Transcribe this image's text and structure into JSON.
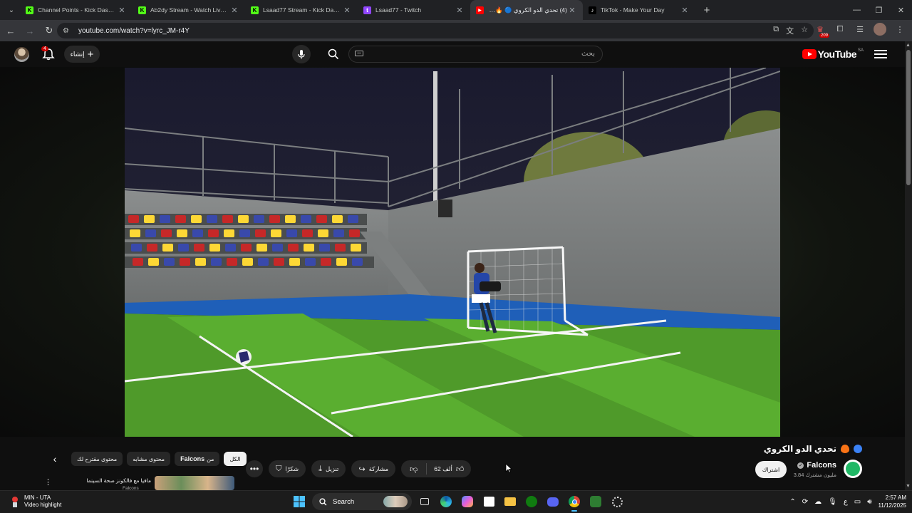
{
  "browser": {
    "tabs": [
      {
        "title": "Channel Points - Kick Dashboard",
        "favicon": "kick-icon",
        "color": "#53fc18",
        "active": false
      },
      {
        "title": "Ab2dy Stream - Watch Live on Kick",
        "favicon": "kick-icon",
        "color": "#53fc18",
        "active": false
      },
      {
        "title": "Lsaad77 Stream - Kick Dashboard",
        "favicon": "kick-icon",
        "color": "#53fc18",
        "active": false
      },
      {
        "title": "Lsaad77 - Twitch",
        "favicon": "twitch-icon",
        "color": "#9146ff",
        "active": false
      },
      {
        "title": "(4) تحدي الدو الكروي 🔵 🔥 - YouTube",
        "favicon": "youtube-icon",
        "color": "#ff0000",
        "active": true
      },
      {
        "title": "TikTok - Make Your Day",
        "favicon": "tiktok-icon",
        "color": "#ffffff",
        "active": false
      }
    ],
    "url": "youtube.com/watch?v=lyrc_JM-r4Y",
    "extension_badge": "209"
  },
  "youtube": {
    "logo_text": "YouTube",
    "region": "SA",
    "search_placeholder": "بحث",
    "create_label": "إنشاء",
    "notification_count": "4"
  },
  "video": {
    "title": "تحدي الدو الكروي",
    "channel_name": "Falcons",
    "subscribers": "3.84 مليون مشترك",
    "subscribe_label": "اشتراك",
    "like_count": "62 ألف",
    "share_label": "مشاركة",
    "download_label": "تنزيل",
    "thanks_label": "شكرًا"
  },
  "chips": {
    "all": "الكل",
    "from_channel_prefix": "من",
    "from_channel_name": "Falcons",
    "related": "محتوى مشابه",
    "recommended": "محتوى مقترح لك"
  },
  "recommendation": {
    "title": "مافيا مع فالكونز صحة السينما",
    "channel": "Falcons"
  },
  "taskbar": {
    "weather_title": "MIN - UTA",
    "weather_subtitle": "Video highlight",
    "search_label": "Search",
    "time": "2:57 AM",
    "date": "11/12/2025",
    "lang": "ع"
  }
}
